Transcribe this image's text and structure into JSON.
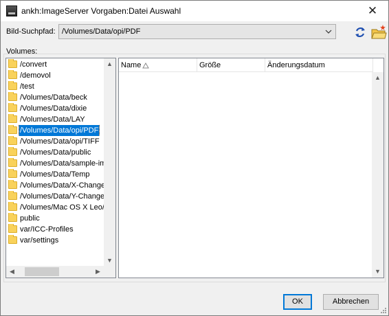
{
  "window": {
    "title": "ankh:ImageServer Vorgaben:Datei Auswahl",
    "close_symbol": "✕"
  },
  "path": {
    "label": "Bild-Suchpfad:",
    "value": "/Volumes/Data/opi/PDF"
  },
  "toolbar": {
    "refresh_icon": "refresh-icon",
    "new_folder_icon": "new-folder-icon"
  },
  "volumes": {
    "label": "Volumes:",
    "selected_index": 6,
    "items": [
      {
        "label": "/convert"
      },
      {
        "label": "/demovol"
      },
      {
        "label": "/test"
      },
      {
        "label": "/Volumes/Data/beck"
      },
      {
        "label": "/Volumes/Data/dixie"
      },
      {
        "label": "/Volumes/Data/LAY"
      },
      {
        "label": "/Volumes/Data/opi/PDF"
      },
      {
        "label": "/Volumes/Data/opi/TIFF"
      },
      {
        "label": "/Volumes/Data/public"
      },
      {
        "label": "/Volumes/Data/sample-im"
      },
      {
        "label": "/Volumes/Data/Temp"
      },
      {
        "label": "/Volumes/Data/X-Change"
      },
      {
        "label": "/Volumes/Data/Y-Change"
      },
      {
        "label": "/Volumes/Mac OS X Leo/I"
      },
      {
        "label": "public"
      },
      {
        "label": "var/ICC-Profiles"
      },
      {
        "label": "var/settings"
      }
    ]
  },
  "files": {
    "columns": [
      {
        "label": "Name",
        "sorted": "ascending"
      },
      {
        "label": "Größe"
      },
      {
        "label": "Änderungsdatum"
      }
    ],
    "rows": []
  },
  "buttons": {
    "ok": "OK",
    "cancel": "Abbrechen"
  },
  "colors": {
    "selection": "#0078d7",
    "folder": "#f9d25b",
    "refresh_icon": "#1f4fb0"
  }
}
